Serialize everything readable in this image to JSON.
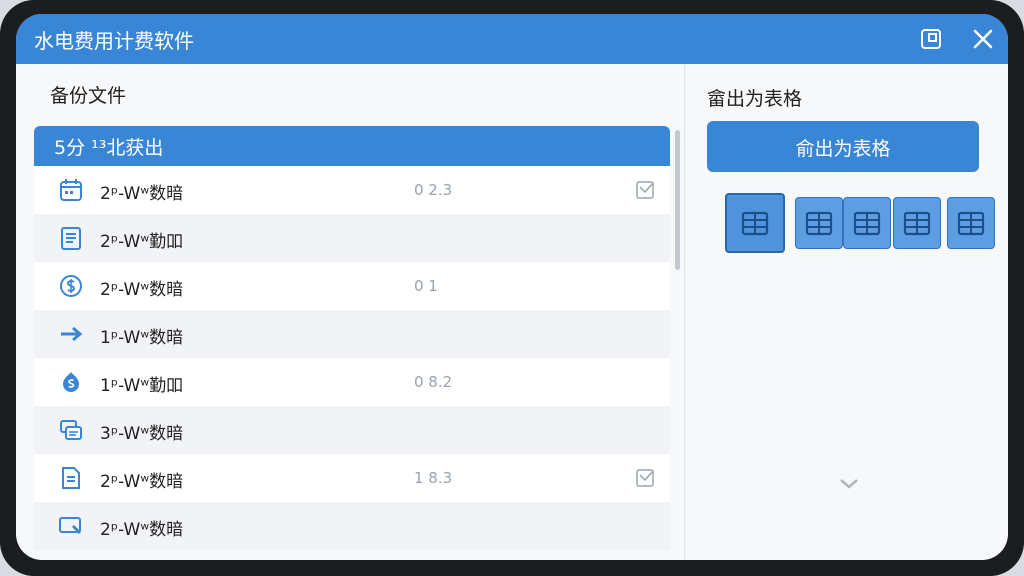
{
  "window": {
    "title": "水电费用计费软件"
  },
  "left": {
    "title": "备份文件",
    "header_label": "5分 ¹³北获出",
    "rows": [
      {
        "icon": "calendar-icon",
        "name": "2ᵖ-Wʷ数暗",
        "value": "0 2.3",
        "check": true
      },
      {
        "icon": "document-icon",
        "name": "2ᵖ-Wʷ勤吅",
        "value": "",
        "check": false
      },
      {
        "icon": "dollar-circle-icon",
        "name": "2ᵖ-Wʷ数暗",
        "value": "0 1",
        "check": false
      },
      {
        "icon": "arrow-right-icon",
        "name": "1ᵖ-Wʷ数暗",
        "value": "",
        "check": false
      },
      {
        "icon": "shield-dollar-icon",
        "name": "1ᵖ-Wʷ勤吅",
        "value": "0 8.2",
        "check": false
      },
      {
        "icon": "layers-icon",
        "name": "3ᵖ-Wʷ数暗",
        "value": "",
        "check": false
      },
      {
        "icon": "file-text-icon",
        "name": "2ᵖ-Wʷ数暗",
        "value": "1 8.3",
        "check": true
      },
      {
        "icon": "screen-edit-icon",
        "name": "2ᵖ-Wʷ数暗",
        "value": "",
        "check": false
      }
    ]
  },
  "right": {
    "title": "畲出为表格",
    "export_label": "俞出为表格",
    "formats": [
      "table-format-icon",
      "table-format-icon",
      "table-format-icon",
      "table-format-icon",
      "table-format-icon"
    ]
  },
  "colors": {
    "accent": "#3a86d6",
    "window_bg": "#f7f8fa"
  }
}
